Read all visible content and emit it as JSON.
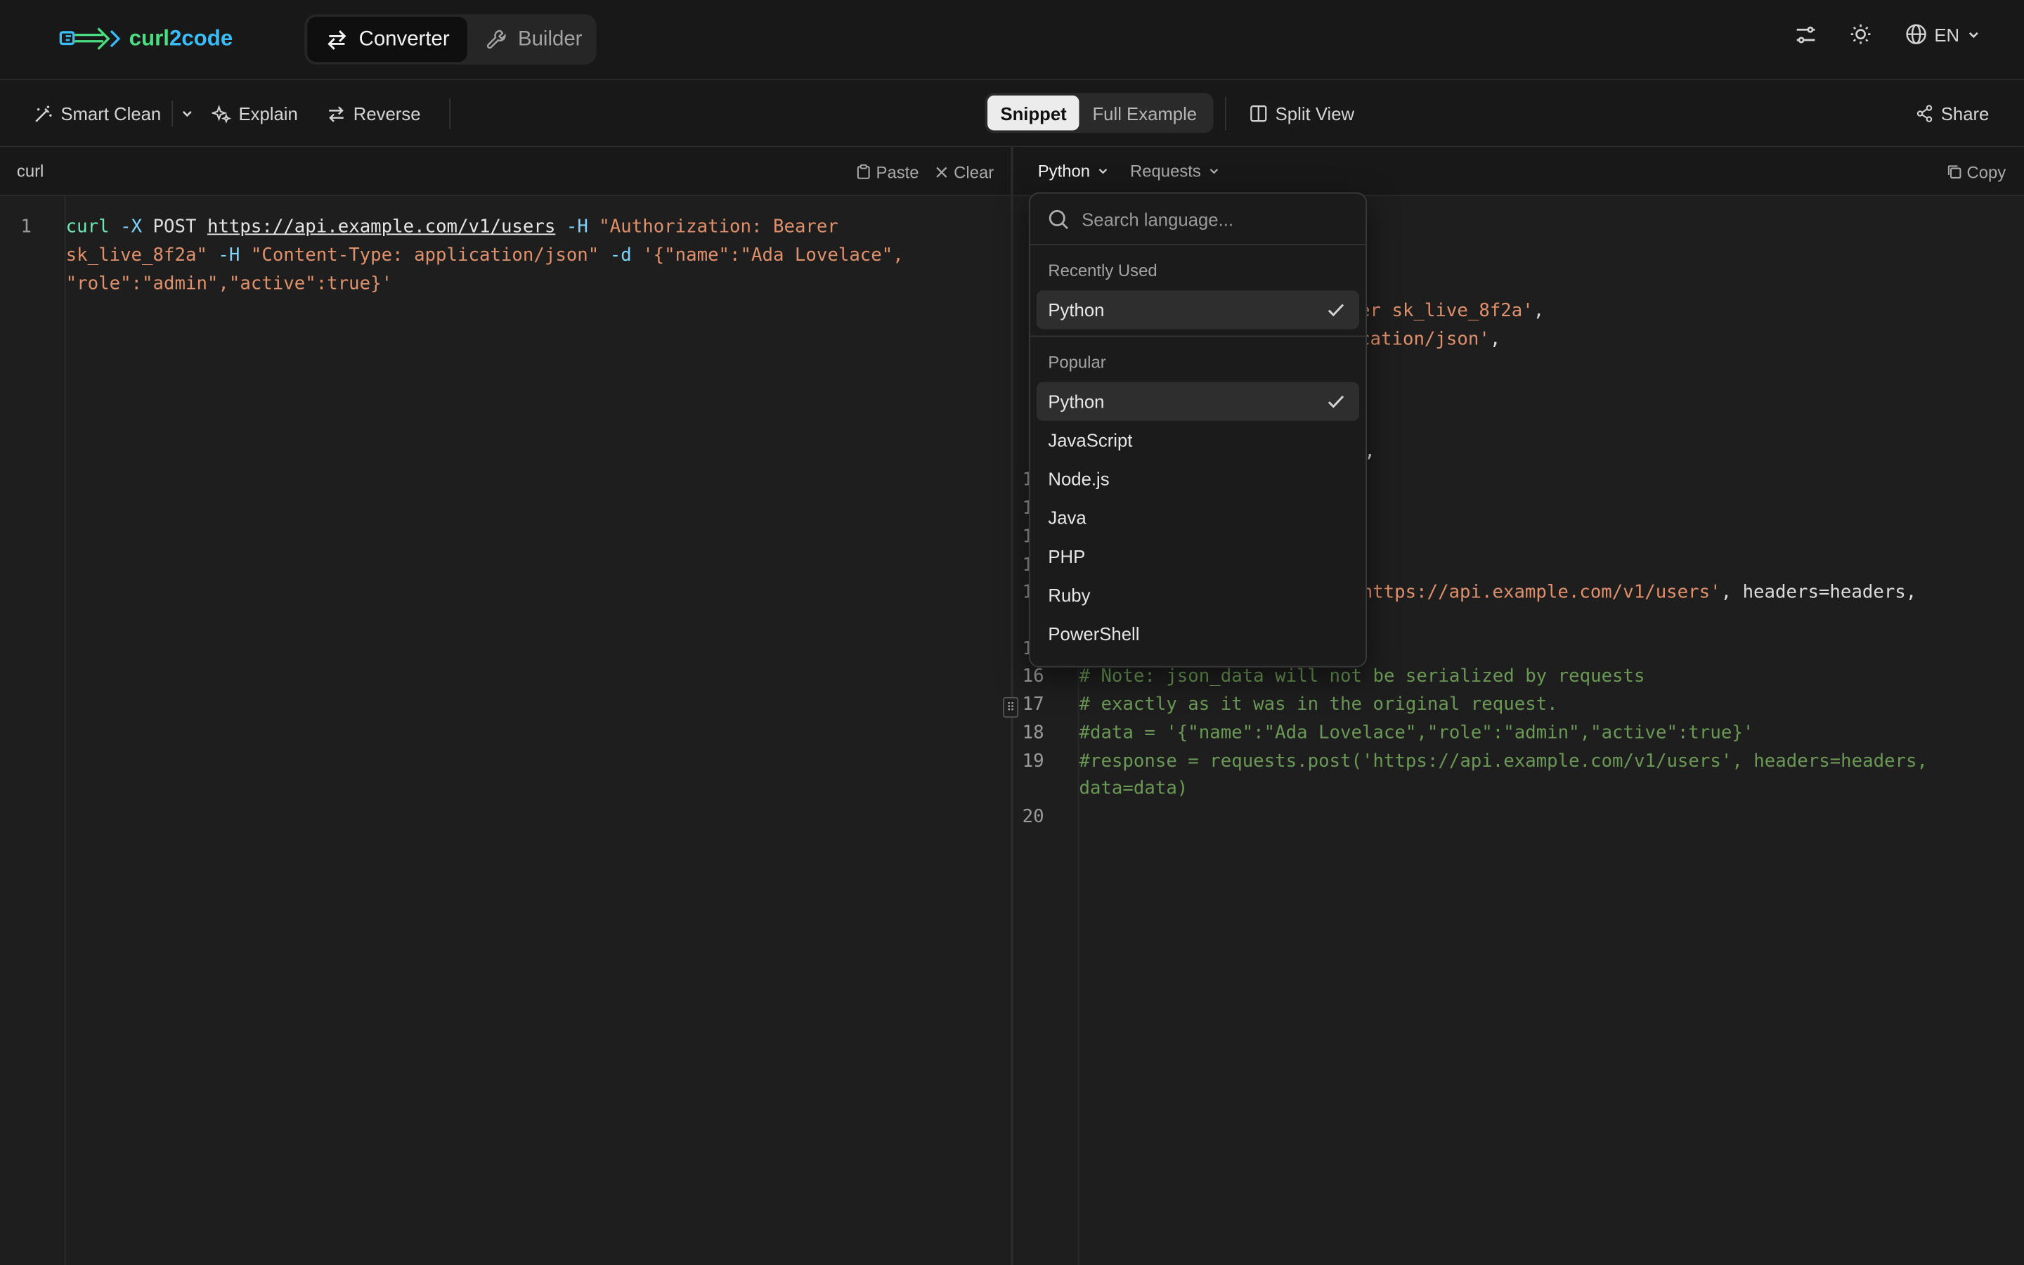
{
  "app": {
    "logo_text_1": "curl",
    "logo_text_2": "2code"
  },
  "modes": [
    {
      "label": "Converter",
      "active": true
    },
    {
      "label": "Builder",
      "active": false
    }
  ],
  "header_right": {
    "language": "EN"
  },
  "toolbar": {
    "smart_clean": "Smart Clean",
    "explain": "Explain",
    "reverse": "Reverse",
    "snippet": "Snippet",
    "full_example": "Full Example",
    "split_view": "Split View",
    "share": "Share"
  },
  "input_panel": {
    "title": "curl",
    "paste": "Paste",
    "clear": "Clear",
    "line_numbers": [
      "1"
    ],
    "lines": [
      [
        {
          "t": "curl",
          "c": "kw"
        },
        {
          "t": " -X ",
          "c": "fl"
        },
        {
          "t": "POST ",
          "c": "pl"
        },
        {
          "t": "https://api.example.com/v1/users",
          "c": "url"
        },
        {
          "t": " -H ",
          "c": "fl"
        },
        {
          "t": "\"Authorization: Bearer",
          "c": "st"
        }
      ],
      [
        {
          "t": "sk_live_8f2a\"",
          "c": "st"
        },
        {
          "t": " -H ",
          "c": "fl"
        },
        {
          "t": "\"Content-Type: application/json\"",
          "c": "st"
        },
        {
          "t": " -d ",
          "c": "fl"
        },
        {
          "t": "'{\"name\":\"Ada Lovelace\",",
          "c": "st"
        }
      ],
      [
        {
          "t": "\"role\":\"admin\",\"active\":true}'",
          "c": "st"
        }
      ]
    ]
  },
  "output_panel": {
    "language": "Python",
    "library": "Requests",
    "copy": "Copy",
    "visible_line_numbers": [
      "1",
      "1",
      "1",
      "1",
      "1",
      "1",
      "16",
      "17",
      "18",
      "19",
      "20"
    ],
    "code_fragments": [
      [
        {
          "t": "er sk_live_8f2a'",
          "c": "st"
        },
        {
          "t": ",",
          "c": "pl"
        }
      ],
      [
        {
          "t": "cation/json'",
          "c": "st"
        },
        {
          "t": ",",
          "c": "pl"
        }
      ],
      [
        {
          "t": ",",
          "c": "pl"
        }
      ],
      [
        {
          "t": "https://api.example.com/v1/users'",
          "c": "st"
        },
        {
          "t": ", headers=headers,",
          "c": "pl"
        }
      ]
    ],
    "comment_lines": [
      "# Note: json_data will not be serialized by requests",
      "# exactly as it was in the original request.",
      "#data = '{\"name\":\"Ada Lovelace\",\"role\":\"admin\",\"active\":true}'",
      "#response = requests.post('https://api.example.com/v1/users', headers=headers,",
      "data=data)"
    ]
  },
  "language_dropdown": {
    "search_placeholder": "Search language...",
    "groups": [
      {
        "label": "Recently Used",
        "items": [
          {
            "label": "Python",
            "selected": true
          }
        ]
      },
      {
        "label": "Popular",
        "items": [
          {
            "label": "Python",
            "selected": true
          },
          {
            "label": "JavaScript",
            "selected": false
          },
          {
            "label": "Node.js",
            "selected": false
          },
          {
            "label": "Java",
            "selected": false
          },
          {
            "label": "PHP",
            "selected": false
          },
          {
            "label": "Ruby",
            "selected": false
          },
          {
            "label": "PowerShell",
            "selected": false
          }
        ]
      }
    ]
  },
  "colors": {
    "accent_green": "#4ade80",
    "accent_blue": "#38bdf8",
    "string": "#e0906a",
    "comment": "#6a9955",
    "flag": "#7dd3fc"
  }
}
